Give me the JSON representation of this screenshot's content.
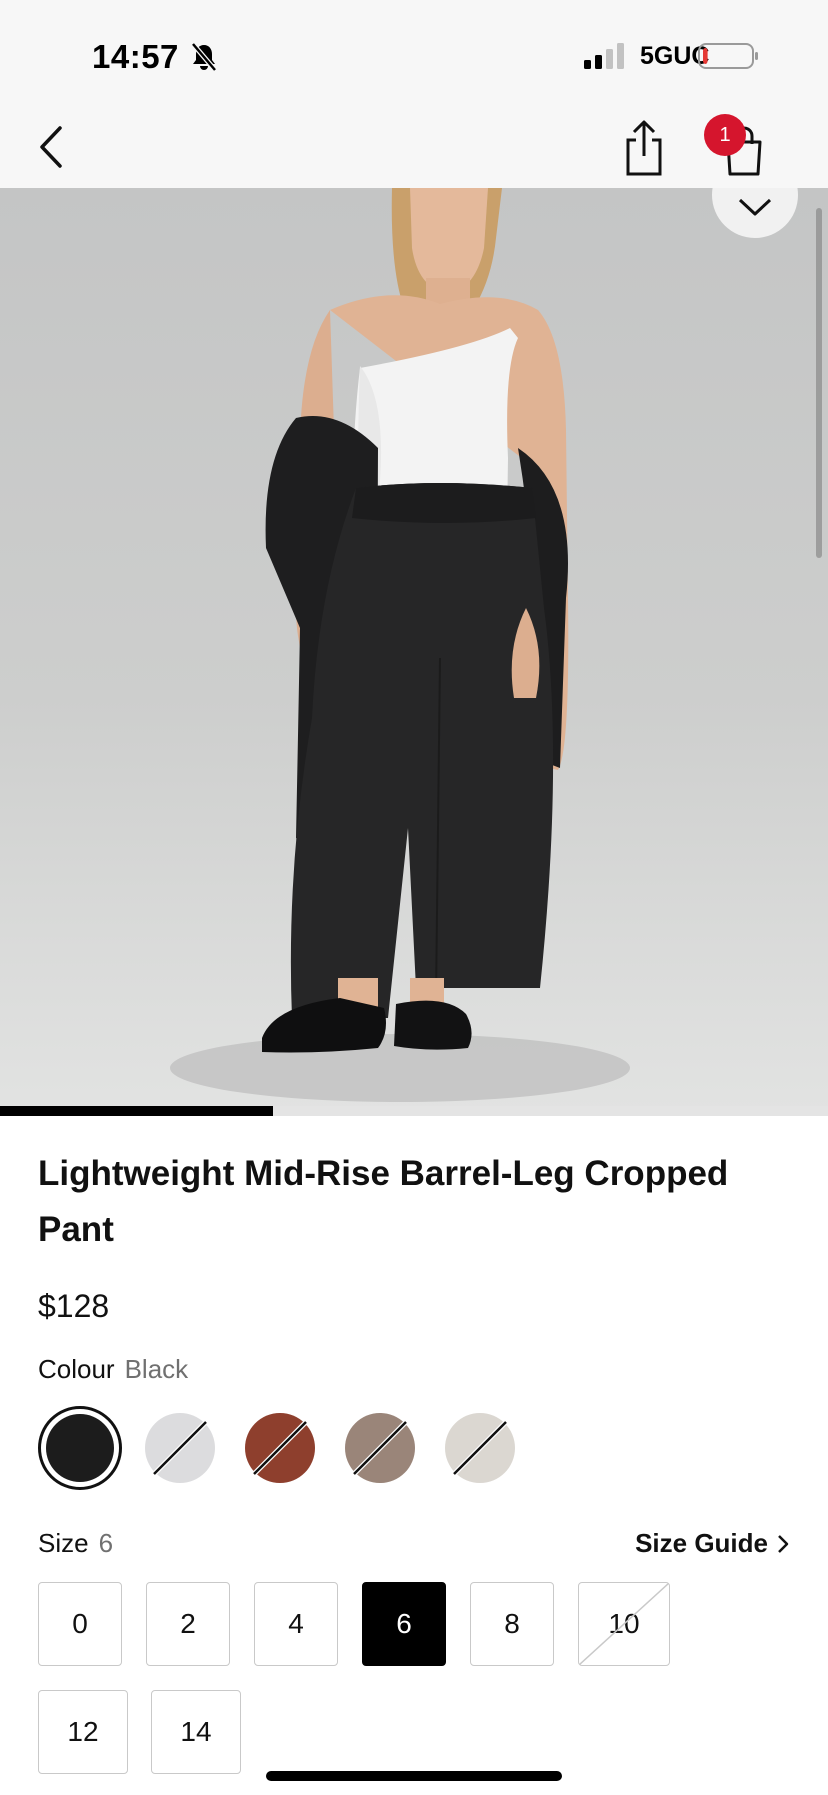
{
  "status_bar": {
    "time": "14:57",
    "network": "5GUC",
    "battery_level": 0.1,
    "battery_color": "#e53935"
  },
  "nav": {
    "back_icon": "chevron-left-icon",
    "share_icon": "share-icon",
    "bag_icon": "shopping-bag-icon",
    "cart_count": "1",
    "badge_color": "#d5152d"
  },
  "hero": {
    "favorite_icon": "heart-icon",
    "image_index": 1,
    "image_progress": 0.33
  },
  "product": {
    "title": "Lightweight Mid-Rise Barrel-Leg Cropped Pant",
    "price": "$128",
    "colour_label": "Colour",
    "colour_value": "Black",
    "colours": [
      {
        "name": "Black",
        "hex": "#1c1c1c",
        "selected": true,
        "available": true
      },
      {
        "name": "Light Grey",
        "hex": "#dcdcde",
        "selected": false,
        "available": false
      },
      {
        "name": "Rust",
        "hex": "#8e3f2d",
        "selected": false,
        "available": false
      },
      {
        "name": "Taupe",
        "hex": "#9a8579",
        "selected": false,
        "available": false
      },
      {
        "name": "Bone",
        "hex": "#dbd7d1",
        "selected": false,
        "available": false
      }
    ],
    "size_label": "Size",
    "size_value": "6",
    "size_guide_label": "Size Guide",
    "sizes": [
      {
        "label": "0",
        "selected": false,
        "available": true
      },
      {
        "label": "2",
        "selected": false,
        "available": true
      },
      {
        "label": "4",
        "selected": false,
        "available": true
      },
      {
        "label": "6",
        "selected": true,
        "available": true
      },
      {
        "label": "8",
        "selected": false,
        "available": true
      },
      {
        "label": "10",
        "selected": false,
        "available": false
      },
      {
        "label": "12",
        "selected": false,
        "available": true
      },
      {
        "label": "14",
        "selected": false,
        "available": true
      }
    ]
  }
}
